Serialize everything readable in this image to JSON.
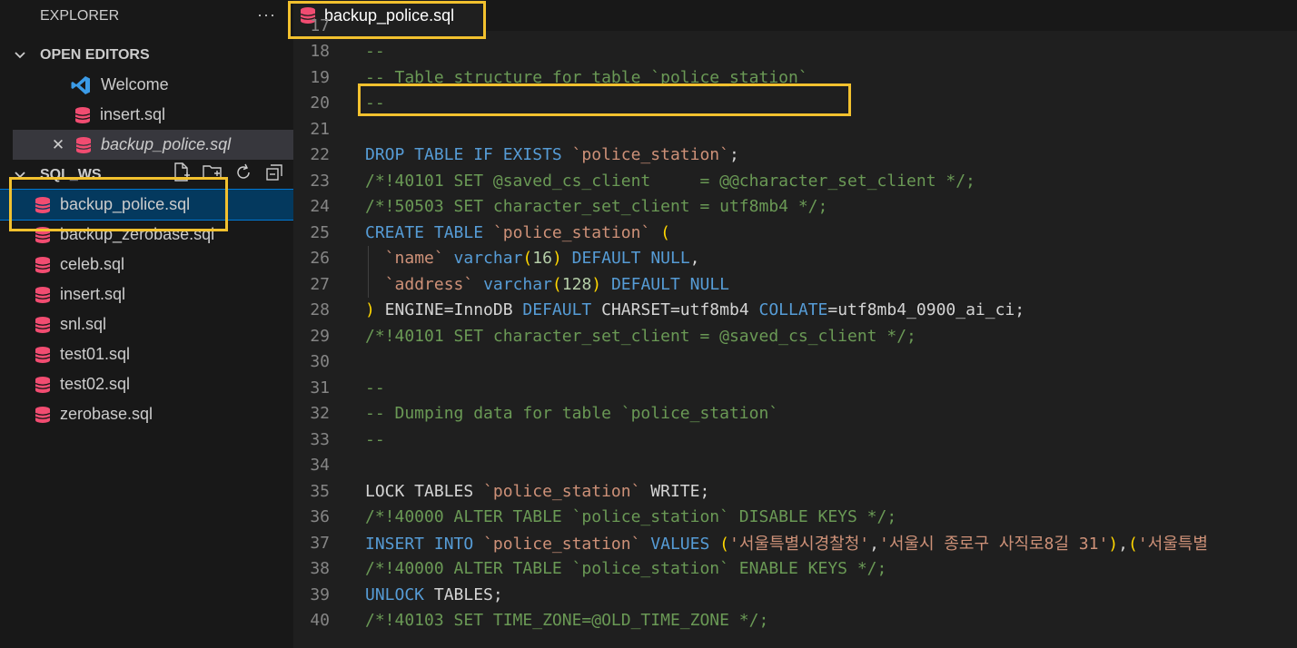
{
  "sidebar": {
    "title": "EXPLORER",
    "more": "···",
    "open_editors": {
      "header": "OPEN EDITORS",
      "items": [
        {
          "label": "Welcome",
          "icon": "vscode-icon"
        },
        {
          "label": "insert.sql",
          "icon": "database-icon"
        },
        {
          "label": "backup_police.sql",
          "icon": "database-icon",
          "close": "✕"
        }
      ]
    },
    "workspace": {
      "header": "SQL_WS",
      "files": [
        "backup_police.sql",
        "backup_zerobase.sql",
        "celeb.sql",
        "insert.sql",
        "snl.sql",
        "test01.sql",
        "test02.sql",
        "zerobase.sql"
      ]
    }
  },
  "editor": {
    "tab_label": "backup_police.sql",
    "line_numbers": [
      "17",
      "18",
      "19",
      "20",
      "21",
      "22",
      "23",
      "24",
      "25",
      "26",
      "27",
      "28",
      "29",
      "30",
      "31",
      "32",
      "33",
      "34",
      "35",
      "36",
      "37",
      "38",
      "39",
      "40"
    ],
    "lines": [
      [],
      [
        [
          "c",
          "--"
        ]
      ],
      [
        [
          "c",
          "-- Table structure for table `police_station`"
        ]
      ],
      [
        [
          "c",
          "--"
        ]
      ],
      [],
      [
        [
          "k",
          "DROP TABLE IF EXISTS "
        ],
        [
          "s",
          "`police_station`"
        ],
        [
          "t",
          ";"
        ]
      ],
      [
        [
          "c",
          "/*!40101 SET @saved_cs_client     = @@character_set_client */;"
        ]
      ],
      [
        [
          "c",
          "/*!50503 SET character_set_client = utf8mb4 */;"
        ]
      ],
      [
        [
          "k",
          "CREATE TABLE "
        ],
        [
          "s",
          "`police_station` "
        ],
        [
          "p",
          "("
        ]
      ],
      [
        [
          "t",
          "  "
        ],
        [
          "s",
          "`name` "
        ],
        [
          "k",
          "varchar"
        ],
        [
          "p",
          "("
        ],
        [
          "n",
          "16"
        ],
        [
          "p",
          ")"
        ],
        [
          "k",
          " DEFAULT NULL"
        ],
        [
          "t",
          ","
        ]
      ],
      [
        [
          "t",
          "  "
        ],
        [
          "s",
          "`address` "
        ],
        [
          "k",
          "varchar"
        ],
        [
          "p",
          "("
        ],
        [
          "n",
          "128"
        ],
        [
          "p",
          ")"
        ],
        [
          "k",
          " DEFAULT NULL"
        ]
      ],
      [
        [
          "p",
          ")"
        ],
        [
          "t",
          " ENGINE=InnoDB "
        ],
        [
          "k",
          "DEFAULT"
        ],
        [
          "t",
          " CHARSET=utf8mb4 "
        ],
        [
          "k",
          "COLLATE"
        ],
        [
          "t",
          "=utf8mb4_0900_ai_ci;"
        ]
      ],
      [
        [
          "c",
          "/*!40101 SET character_set_client = @saved_cs_client */;"
        ]
      ],
      [],
      [
        [
          "c",
          "--"
        ]
      ],
      [
        [
          "c",
          "-- Dumping data for table `police_station`"
        ]
      ],
      [
        [
          "c",
          "--"
        ]
      ],
      [],
      [
        [
          "t",
          "LOCK TABLES "
        ],
        [
          "s",
          "`police_station` "
        ],
        [
          "t",
          "WRITE;"
        ]
      ],
      [
        [
          "c",
          "/*!40000 ALTER TABLE `police_station` DISABLE KEYS */;"
        ]
      ],
      [
        [
          "k",
          "INSERT INTO "
        ],
        [
          "s",
          "`police_station` "
        ],
        [
          "k",
          "VALUES "
        ],
        [
          "p",
          "("
        ],
        [
          "s",
          "'서울특별시경찰청'"
        ],
        [
          "t",
          ","
        ],
        [
          "s",
          "'서울시 종로구 사직로8길 31'"
        ],
        [
          "p",
          ")"
        ],
        [
          "t",
          ","
        ],
        [
          "p",
          "("
        ],
        [
          "s",
          "'서울특별"
        ]
      ],
      [
        [
          "c",
          "/*!40000 ALTER TABLE `police_station` ENABLE KEYS */;"
        ]
      ],
      [
        [
          "k",
          "UNLOCK"
        ],
        [
          "t",
          " TABLES;"
        ]
      ],
      [
        [
          "c",
          "/*!40103 SET TIME_ZONE=@OLD_TIME_ZONE */;"
        ]
      ]
    ]
  },
  "colors": {
    "highlight": "#f2c12e",
    "comment": "#6a9955",
    "keyword": "#569cd6",
    "string": "#ce9178",
    "sql_icon": "#f14c71"
  }
}
